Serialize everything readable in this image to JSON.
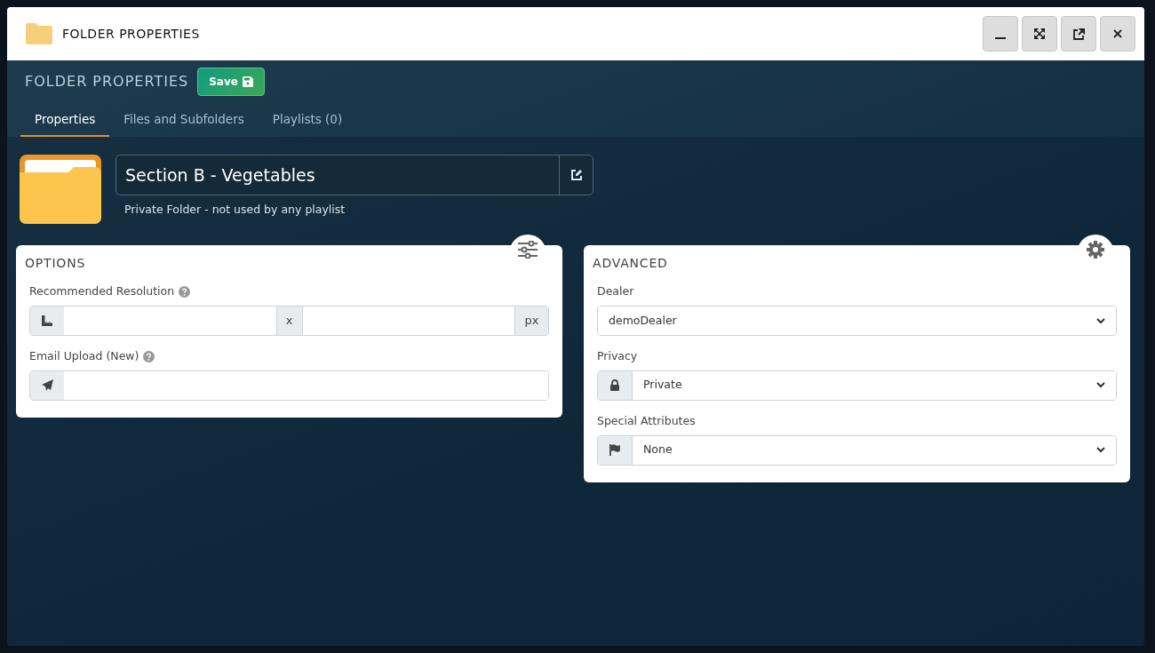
{
  "window": {
    "title": "FOLDER PROPERTIES",
    "buttons": [
      {
        "kind": "minimize"
      },
      {
        "kind": "maximize"
      },
      {
        "kind": "popout"
      },
      {
        "kind": "close"
      }
    ]
  },
  "toolbar": {
    "heading": "FOLDER PROPERTIES",
    "save_label": "Save"
  },
  "tabs": [
    {
      "label": "Properties",
      "selected": true
    },
    {
      "label": "Files and Subfolders",
      "selected": false
    },
    {
      "label": "Playlists (0)",
      "selected": false
    }
  ],
  "folder": {
    "name": "Section B - Vegetables",
    "note": "Private Folder - not used by any playlist"
  },
  "options": {
    "title": "OPTIONS",
    "resolution_label": "Recommended Resolution",
    "separator": "x",
    "unit": "px",
    "email_label": "Email Upload (New)"
  },
  "advanced": {
    "title": "ADVANCED",
    "fields": [
      {
        "label": "Dealer",
        "value": "demoDealer",
        "kind": "plain"
      },
      {
        "label": "Privacy",
        "value": "Private",
        "kind": "locked"
      },
      {
        "label": "Special Attributes",
        "value": "None",
        "kind": "flagged"
      }
    ]
  }
}
